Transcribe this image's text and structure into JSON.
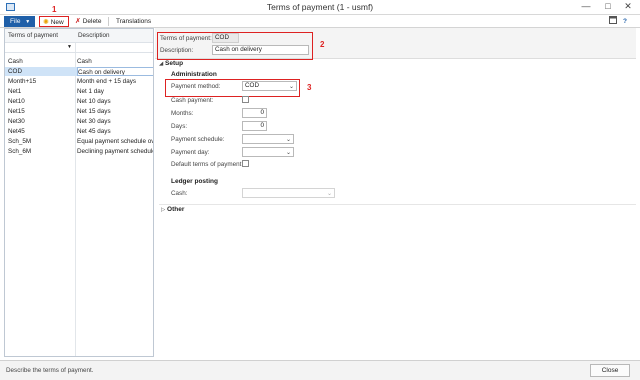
{
  "window": {
    "title": "Terms of payment (1 - usmf)"
  },
  "toolbar": {
    "file_label": "File",
    "new_label": "New",
    "delete_label": "Delete",
    "translations_label": "Translations"
  },
  "annotations": {
    "n1": "1",
    "n2": "2",
    "n3": "3"
  },
  "grid": {
    "columns": [
      "Terms of payment",
      "Description"
    ],
    "rows": [
      {
        "term": "Cash",
        "desc": "Cash"
      },
      {
        "term": "COD",
        "desc": "Cash on delivery"
      },
      {
        "term": "Month+15",
        "desc": "Month end + 15 days"
      },
      {
        "term": "Net1",
        "desc": "Net 1 day"
      },
      {
        "term": "Net10",
        "desc": "Net 10 days"
      },
      {
        "term": "Net15",
        "desc": "Net 15 days"
      },
      {
        "term": "Net30",
        "desc": "Net 30 days"
      },
      {
        "term": "Net45",
        "desc": "Net 45 days"
      },
      {
        "term": "Sch_5M",
        "desc": "Equal payment schedule ove"
      },
      {
        "term": "Sch_6M",
        "desc": "Declining payment schedule"
      }
    ]
  },
  "header": {
    "terms_label": "Terms of payment:",
    "terms_value": "COD",
    "desc_label": "Description:",
    "desc_value": "Cash on delivery"
  },
  "setup": {
    "title": "Setup",
    "admin_title": "Administration",
    "payment_method_label": "Payment method:",
    "payment_method_value": "COD",
    "cash_payment_label": "Cash payment:",
    "months_label": "Months:",
    "months_value": "0",
    "days_label": "Days:",
    "days_value": "0",
    "schedule_label": "Payment schedule:",
    "payday_label": "Payment day:",
    "default_label": "Default terms of payment:",
    "ledger_title": "Ledger posting",
    "cash_label": "Cash:"
  },
  "other": {
    "title": "Other"
  },
  "status": {
    "text": "Describe the terms of payment.",
    "close_label": "Close"
  }
}
